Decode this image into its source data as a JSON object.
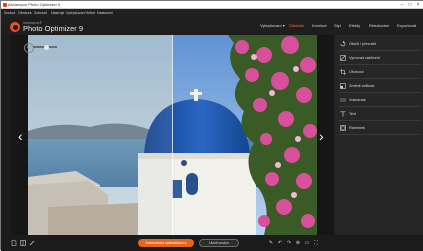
{
  "window": {
    "title": "Ashampoo Photo Optimizer 9",
    "controls": {
      "minimize": "–",
      "maximize": "□",
      "close": "×"
    }
  },
  "menubar": {
    "items": [
      "Soubor",
      "Obrázek",
      "Zobrazit",
      "Nástroje",
      "Vylepšovaní",
      "Sdílet",
      "Nastavení"
    ]
  },
  "header": {
    "brand_small": "Ashampoo®",
    "brand": "Photo Optimizer 9",
    "modes": [
      {
        "label": "Vylepšovaní ▾",
        "active": false
      },
      {
        "label": "Základní",
        "active": true
      },
      {
        "label": "Korekce",
        "active": false
      },
      {
        "label": "Styl",
        "active": false
      },
      {
        "label": "Efekty",
        "active": false
      },
      {
        "label": "Retušování",
        "active": false
      },
      {
        "label": "Exportovat",
        "active": false
      }
    ]
  },
  "canvas": {
    "undo_icon": "undo-icon",
    "compare_slider_level": 0.5
  },
  "panel": {
    "tools": [
      {
        "label": "Otočit / převrátit",
        "icon": "rotate-icon"
      },
      {
        "label": "Vyrovnat zakřivení",
        "icon": "straighten-icon"
      },
      {
        "label": "Oříznout",
        "icon": "crop-icon"
      },
      {
        "label": "Změnit velikost",
        "icon": "resize-icon"
      },
      {
        "label": "Vodoznak",
        "icon": "watermark-icon"
      },
      {
        "label": "Text",
        "icon": "text-icon"
      },
      {
        "label": "Rámeček",
        "icon": "frame-icon"
      }
    ]
  },
  "bottombar": {
    "apply_label": "Automatická optimalizace ▸",
    "save_label": "Uložit soubor",
    "left_icons": [
      "file-icon",
      "compare-icon",
      "paint-icon"
    ],
    "right_icons": [
      "brush-icon",
      "undo-icon",
      "redo-icon",
      "zoom-icon",
      "fit-icon",
      "fullscreen-icon"
    ]
  },
  "colors": {
    "accent": "#e9641f",
    "background": "#1b1b1b",
    "panel": "#262626"
  }
}
